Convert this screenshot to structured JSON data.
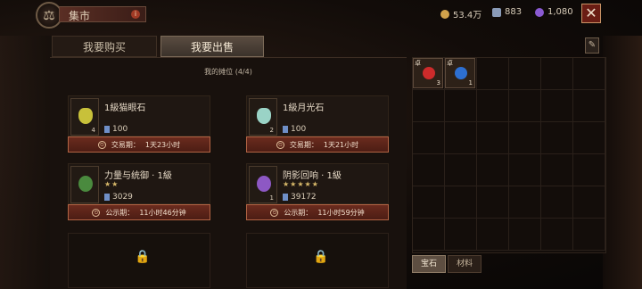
{
  "header": {
    "title": "集市",
    "currencies": [
      {
        "name": "gold",
        "value": "53.4万",
        "color": "#d1a24b"
      },
      {
        "name": "crest",
        "value": "883",
        "color": "#8a9bb8"
      },
      {
        "name": "orb",
        "value": "1,080",
        "color": "#8a5ad2"
      }
    ]
  },
  "tabs": [
    "我要购买",
    "我要出售"
  ],
  "stall": {
    "title": "我的摊位 (4/4)",
    "items": [
      {
        "name": "1級猫眼石",
        "qty": "4",
        "stars": "",
        "price": "100",
        "status_label": "交易期：",
        "status_time": "1天23小时",
        "gem_color": "#c8c13a"
      },
      {
        "name": "1級月光石",
        "qty": "2",
        "stars": "",
        "price": "100",
        "status_label": "交易期：",
        "status_time": "1天21小时",
        "gem_color": "#9ad3c6"
      },
      {
        "name": "力量与统御 · 1級",
        "qty": "",
        "stars": "★★",
        "price": "3029",
        "status_label": "公示期：",
        "status_time": "11小时46分钟",
        "gem_color": "#4a8a3e"
      },
      {
        "name": "阴影回响 · 1級",
        "qty": "1",
        "stars": "★★★★★",
        "price": "39172",
        "status_label": "公示期：",
        "status_time": "11小时59分钟",
        "gem_color": "#8d58c4"
      }
    ]
  },
  "inventory": {
    "items": [
      {
        "tag": "卓",
        "qty": "3",
        "gem_color": "#cc2b2b"
      },
      {
        "tag": "卓",
        "qty": "1",
        "gem_color": "#2d6fd1"
      }
    ],
    "tabs": [
      "宝石",
      "材料"
    ]
  },
  "icons": {
    "emblem": "⚖",
    "info": "i",
    "close": "✕",
    "edit": "✎",
    "lock": "🔒",
    "clock": "⏲"
  }
}
